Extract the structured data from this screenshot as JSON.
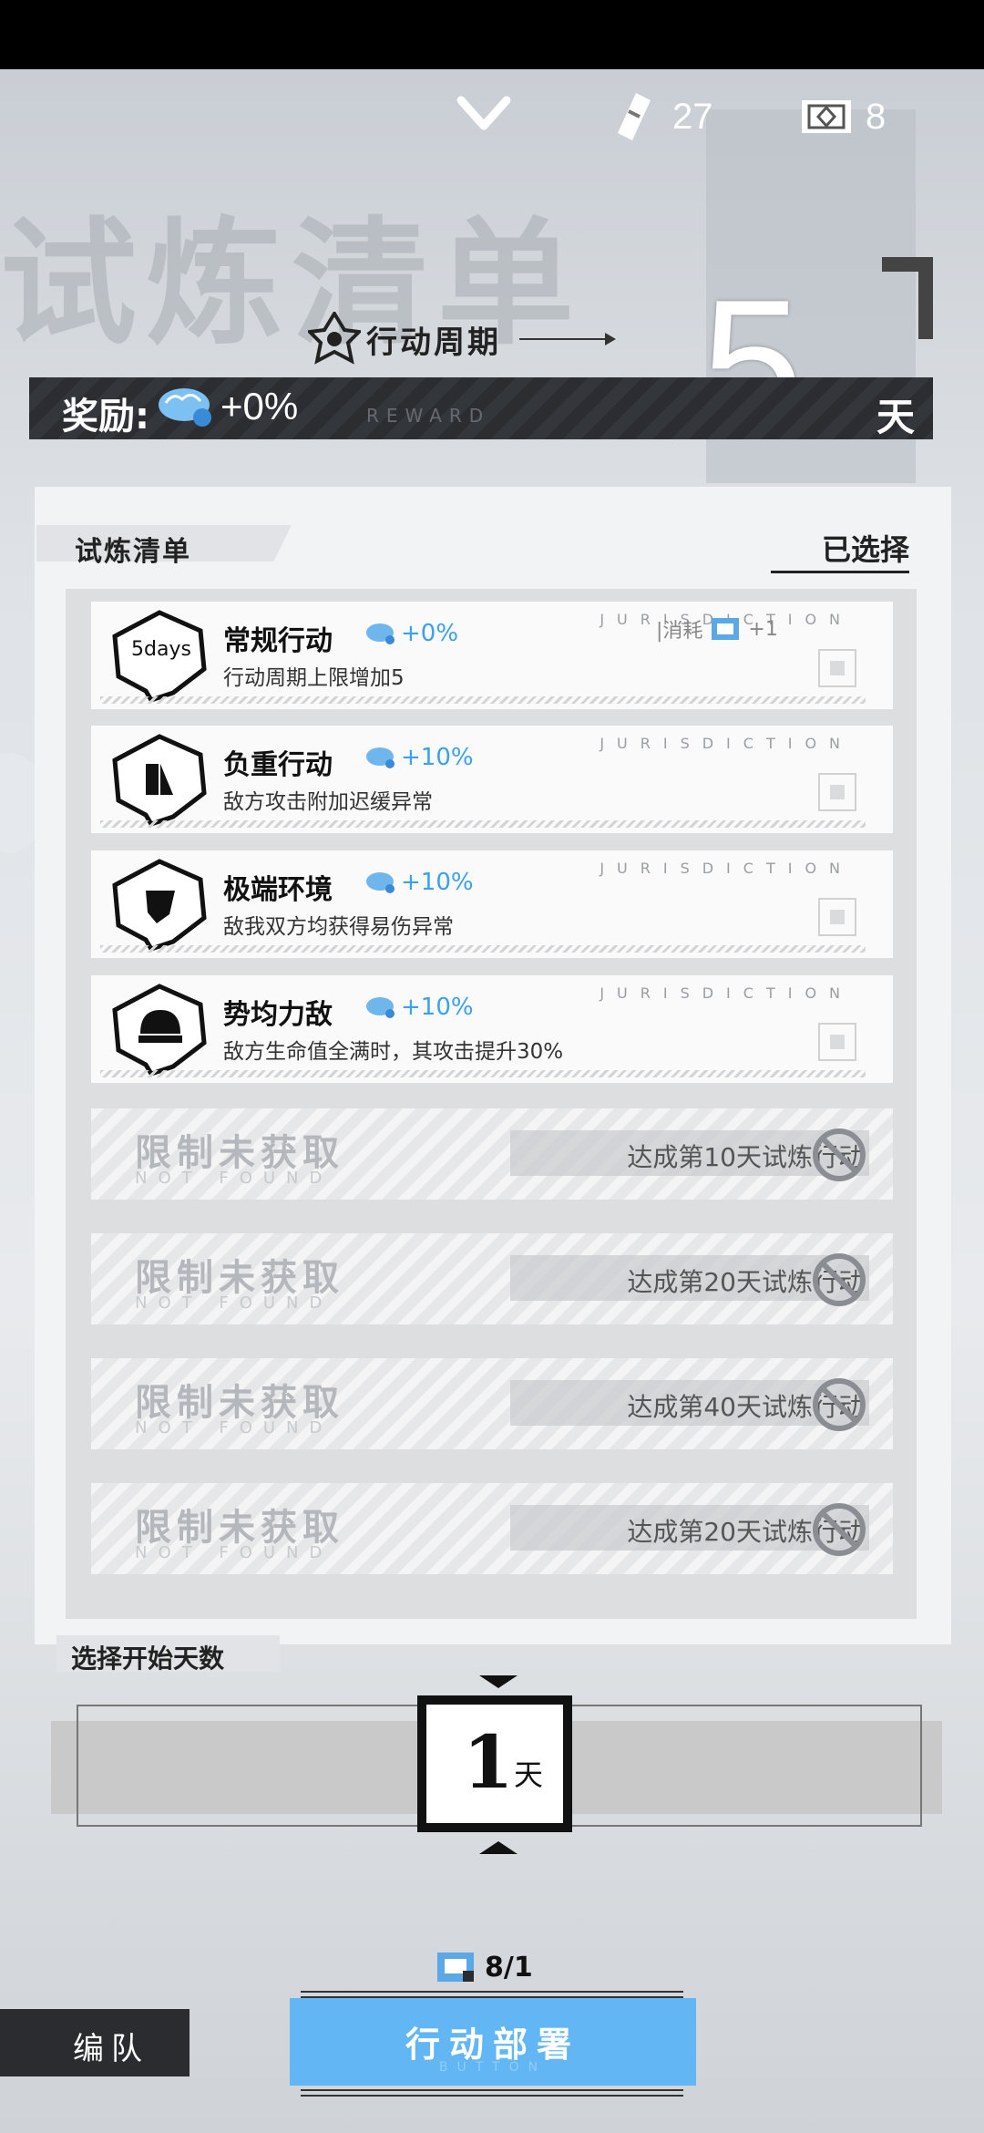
{
  "header": {
    "stamina_count": "27",
    "ticket_count": "8"
  },
  "watermark": "试炼清单",
  "cycle": {
    "label": "行动周期",
    "days": "5",
    "days_unit": "天"
  },
  "reward": {
    "label": "奖励:",
    "value": "+0%",
    "sub": "REWARD"
  },
  "list_section": {
    "title": "试炼清单",
    "selected_label": "已选择"
  },
  "cards": [
    {
      "name": "常规行动",
      "bonus": "+0%",
      "desc": "行动周期上限增加5",
      "juris": "JURISDICTION",
      "cost_label": "|消耗",
      "cost_value": "+1",
      "emblem": "5days"
    },
    {
      "name": "负重行动",
      "bonus": "+10%",
      "desc": "敌方攻击附加迟缓异常",
      "juris": "JURISDICTION"
    },
    {
      "name": "极端环境",
      "bonus": "+10%",
      "desc": "敌我双方均获得易伤异常",
      "juris": "JURISDICTION"
    },
    {
      "name": "势均力敌",
      "bonus": "+10%",
      "desc": "敌方生命值全满时，其攻击提升30%",
      "juris": "JURISDICTION"
    }
  ],
  "locked": [
    {
      "title": "限制未获取",
      "sub": "NOT FOUND",
      "condition": "达成第10天试炼行动"
    },
    {
      "title": "限制未获取",
      "sub": "NOT FOUND",
      "condition": "达成第20天试炼行动"
    },
    {
      "title": "限制未获取",
      "sub": "NOT FOUND",
      "condition": "达成第40天试炼行动"
    },
    {
      "title": "限制未获取",
      "sub": "NOT FOUND",
      "condition": "达成第20天试炼行动"
    }
  ],
  "start_day": {
    "title": "选择开始天数",
    "value": "1",
    "unit": "天"
  },
  "footer": {
    "team_label": "编队",
    "cost": "8/1",
    "deploy_label": "行动部署",
    "deploy_sub": "BUTTON"
  },
  "colors": {
    "accent": "#62b6f4",
    "bonus": "#3aa0f2",
    "dark": "#2a2c30"
  }
}
